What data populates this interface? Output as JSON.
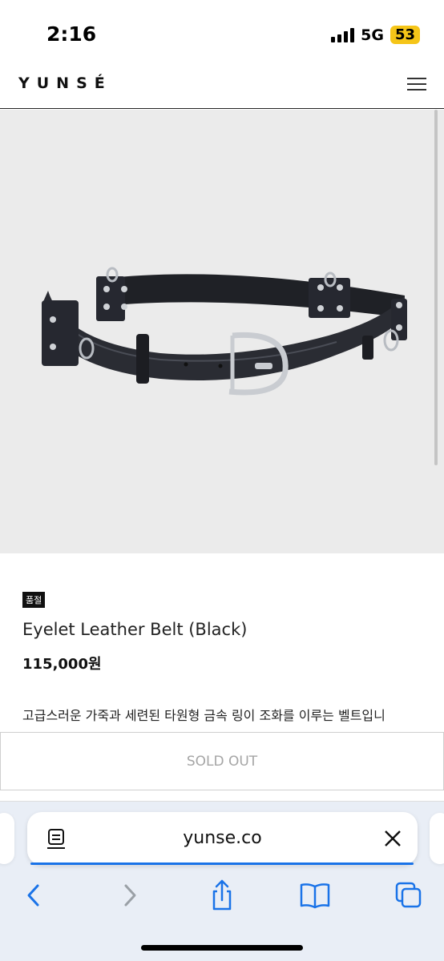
{
  "status_bar": {
    "time": "2:16",
    "network": "5G",
    "battery": "53"
  },
  "header": {
    "logo": "YUNSÉ",
    "menu_icon": "hamburger-menu-icon"
  },
  "product": {
    "badge": "품절",
    "name": "Eyelet Leather Belt (Black)",
    "price": "115,000원",
    "description": "고급스러운 가죽과 세련된 타원형 금속 링이 조화를 이루는 벨트입니",
    "action_label": "SOLD OUT"
  },
  "browser": {
    "url": "yunse.co",
    "icons": [
      "reader-icon",
      "close-icon",
      "back-icon",
      "forward-icon",
      "share-icon",
      "bookmarks-icon",
      "tabs-icon"
    ]
  },
  "colors": {
    "accent": "#1a73e8",
    "battery": "#f5c518",
    "image_bg": "#ebebeb",
    "browser_bg": "#e9eef6"
  }
}
